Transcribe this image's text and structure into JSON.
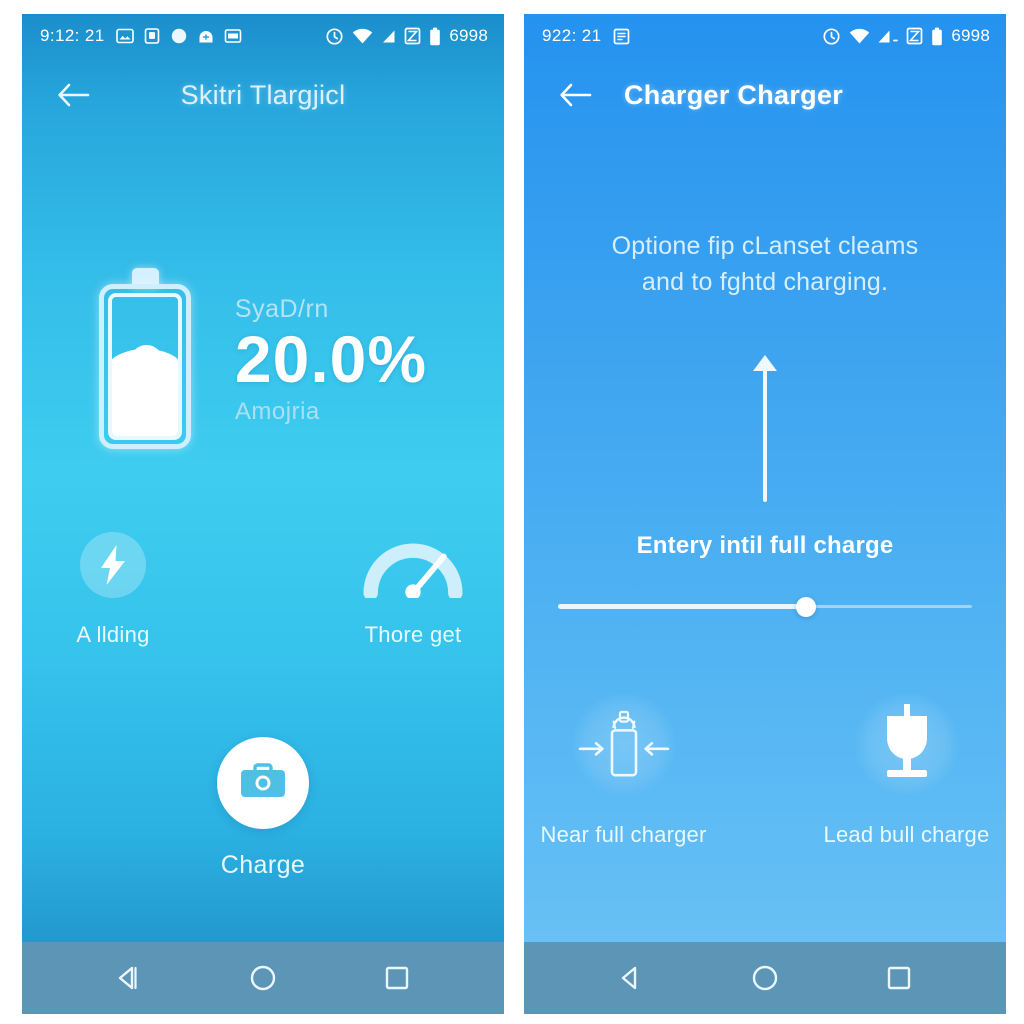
{
  "meta": {
    "colors": {
      "left_top": "#1b8ecb",
      "left_mid": "#3ecdf0",
      "right_top": "#2492ef",
      "right_bottom": "#6fc4f5",
      "navbar": "#5d95b7",
      "text_primary": "#ffffff",
      "text_muted": "#bfe6f7",
      "page_background": "#ffffff"
    }
  },
  "left_phone": {
    "statusbar": {
      "time": "9:12: 21",
      "battery_text": "6998",
      "left_icons": [
        "photo-icon",
        "sdcard-icon",
        "dot-icon",
        "download-icon",
        "archive-icon"
      ],
      "right_icons": [
        "alarm-icon",
        "wifi-icon",
        "signal-icon",
        "sync-icon",
        "battery-icon"
      ]
    },
    "appbar": {
      "back_icon": "back-arrow-icon",
      "title": "Skitri Tlargjicl"
    },
    "battery": {
      "label_top": "SyaD/rn",
      "percent": "20.0%",
      "label_bottom": "Amojria",
      "fill_level": 56
    },
    "quick_actions": [
      {
        "label": "A llding",
        "icon": "lightning-bolt-icon"
      },
      {
        "label": "Thore get",
        "icon": "speedometer-gauge-icon"
      }
    ],
    "charge_button": {
      "label": "Charge",
      "icon": "toolbox-camera-icon"
    },
    "navbar": {
      "back": "nav-back-icon",
      "home": "nav-home-icon",
      "recents": "nav-recents-icon"
    }
  },
  "right_phone": {
    "statusbar": {
      "time": "922: 21",
      "battery_text": "6998",
      "left_icons": [
        "list-icon"
      ],
      "right_icons": [
        "alarm-icon",
        "wifi-icon",
        "signal-icon",
        "sync-icon",
        "battery-icon"
      ]
    },
    "appbar": {
      "back_icon": "back-arrow-icon",
      "title": "Charger Charger"
    },
    "hint_line_1": "Optione fip cLanset cleams",
    "hint_line_2": "and to fghtd charging.",
    "arrow_icon": "up-arrow-icon",
    "slider": {
      "label": "Entery intil full charge",
      "value": 60
    },
    "modes": [
      {
        "label": "Near full charger",
        "icon": "battery-compress-arrows-icon"
      },
      {
        "label": "Lead bull charge",
        "icon": "goblet-plug-icon"
      }
    ],
    "navbar": {
      "back": "nav-back-icon",
      "home": "nav-home-icon",
      "recents": "nav-recents-icon"
    }
  }
}
